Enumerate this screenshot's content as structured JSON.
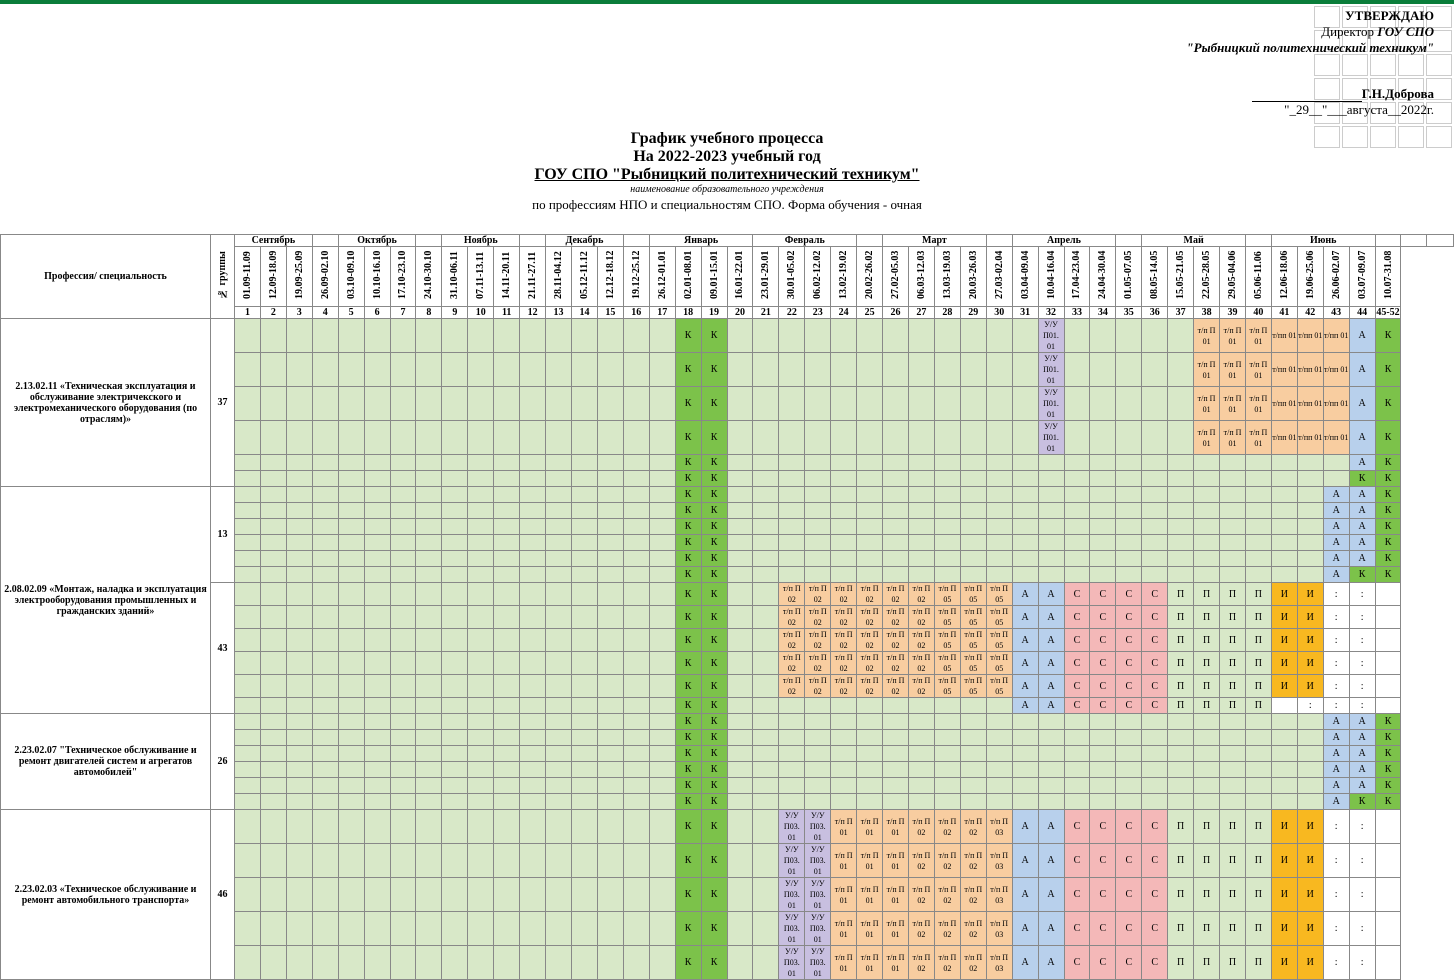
{
  "header": {
    "approve": "УТВЕРЖДАЮ",
    "director_prefix": "Директор",
    "director_org": "ГОУ СПО",
    "org_full": "\"Рыбницкий политехнический техникум\"",
    "name": "Г.Н.Доброва",
    "date": "\"_29__\"___августа__2022г."
  },
  "title": {
    "line1": "График учебного процесса",
    "line2": "На 2022-2023 учебный год",
    "line3": "ГОУ  СПО \"Рыбницкий политехнический техникум\"",
    "sub": "наименование образовательного учреждения",
    "line4": "по профессиям НПО и специальностям СПО. Форма обучения - очная"
  },
  "col_heads": {
    "prof": "Профессия/ специальность",
    "group": "№ группы"
  },
  "months": [
    "Сентябрь",
    "",
    "Октябрь",
    "",
    "Ноябрь",
    "",
    "Декабрь",
    "",
    "Январь",
    "Февраль",
    "",
    "Март",
    "",
    "Апрель",
    "",
    "Май",
    "",
    "Июнь",
    "",
    "",
    ""
  ],
  "month_spans": [
    3,
    1,
    3,
    1,
    3,
    1,
    3,
    1,
    4,
    4,
    1,
    4,
    1,
    4,
    1,
    4,
    1,
    4,
    1,
    1,
    1
  ],
  "weeks": [
    "01.09-11.09",
    "12.09-18.09",
    "19.09-25.09",
    "26.09-02.10",
    "03.10-09.10",
    "10.10-16.10",
    "17.10-23.10",
    "24.10-30.10",
    "31.10-06.11",
    "07.11-13.11",
    "14.11-20.11",
    "21.11-27.11",
    "28.11-04.12",
    "05.12-11.12",
    "12.12-18.12",
    "19.12-25.12",
    "26.12-01.01",
    "02.01-08.01",
    "09.01-15.01",
    "16.01-22.01",
    "23.01-29.01",
    "30.01-05.02",
    "06.02-12.02",
    "13.02-19.02",
    "20.02-26.02",
    "27.02-05.03",
    "06.03-12.03",
    "13.03-19.03",
    "20.03-26.03",
    "27.03-02.04",
    "03.04-09.04",
    "10.04-16.04",
    "17.04-23.04",
    "24.04-30.04",
    "01.05-07.05",
    "08.05-14.05",
    "15.05-21.05",
    "22.05-28.05",
    "29.05-04.06",
    "05.06-11.06",
    "12.06-18.06",
    "19.06-25.06",
    "26.06-02.07",
    "03.07-09.07",
    "10.07-31.08"
  ],
  "week_nums": [
    "1",
    "2",
    "3",
    "4",
    "5",
    "6",
    "7",
    "8",
    "9",
    "10",
    "11",
    "12",
    "13",
    "14",
    "15",
    "16",
    "17",
    "18",
    "19",
    "20",
    "21",
    "22",
    "23",
    "24",
    "25",
    "26",
    "27",
    "28",
    "29",
    "30",
    "31",
    "32",
    "33",
    "34",
    "35",
    "36",
    "37",
    "38",
    "39",
    "40",
    "41",
    "42",
    "43",
    "44",
    "45-52"
  ],
  "legend": {
    "K": "К",
    "A": "А",
    "C": "С",
    "P": "П",
    "I": "И",
    "TP": "т/п",
    "TPP": "т/пп",
    "UU": "у/у",
    "colon": ":"
  },
  "rows": [
    {
      "prof": "2.13.02.11 «Техническая эксплуатация и обслуживание электричекского и электромеханического оборудования (по отраслям)»",
      "group": "37",
      "sub_rows": 6,
      "pattern": "A",
      "special": {
        "32": "UU",
        "38": "TP",
        "39": "TP",
        "40": "TP",
        "41": "TPP",
        "42": "TPP",
        "43": "TPP"
      },
      "end_col": [
        "A",
        "A",
        "A",
        "A",
        "A",
        "K"
      ],
      "last": "K"
    },
    {
      "prof": "2.08.02.09 «Монтаж, наладка и эксплуатация электрооборудования промышленных и гражданских зданий»",
      "group": "13",
      "sub_rows": 6,
      "pattern": "B",
      "end_cols": [
        [
          "A",
          "A"
        ],
        [
          "A",
          "A"
        ],
        [
          "A",
          "A"
        ],
        [
          "A",
          "A"
        ],
        [
          "A",
          "A"
        ],
        [
          "A",
          "K"
        ]
      ],
      "last": "K"
    },
    {
      "prof_span": true,
      "group": "43",
      "sub_rows": 6,
      "pattern": "C",
      "tp_labels": [
        "т/п П 02",
        "т/п П 02",
        "т/п П 02",
        "т/п П 02",
        "т/п П 02",
        "т/п П 02",
        "т/п П 05",
        "т/п П 05",
        "т/п П 05"
      ],
      "last": ""
    },
    {
      "prof": "2.23.02.07 \"Техническое обслуживание и ремонт двигателей систем и агрегатов автомобилей\"",
      "group": "26",
      "sub_rows": 6,
      "pattern": "B",
      "end_cols": [
        [
          "A",
          "A"
        ],
        [
          "A",
          "A"
        ],
        [
          "A",
          "A"
        ],
        [
          "A",
          "A"
        ],
        [
          "A",
          "A"
        ],
        [
          "A",
          "K"
        ]
      ],
      "last": "K"
    },
    {
      "prof": "2.23.02.03 «Техническое обслуживание и ремонт автомобильного транспорта»",
      "group": "46",
      "sub_rows": 5,
      "pattern": "D",
      "last": ""
    }
  ],
  "chart_data": null
}
